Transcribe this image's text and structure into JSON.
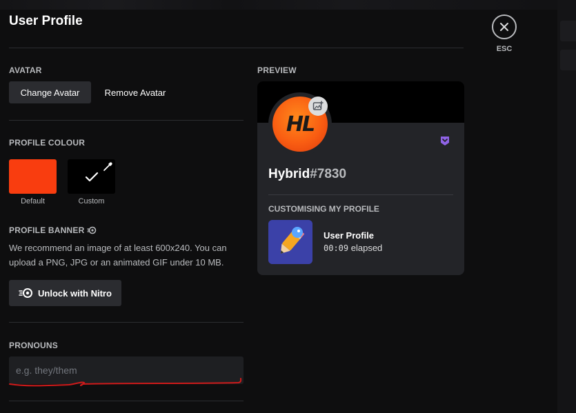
{
  "page": {
    "title": "User Profile"
  },
  "close": {
    "label": "ESC"
  },
  "avatar_section": {
    "label": "AVATAR",
    "change_label": "Change Avatar",
    "remove_label": "Remove Avatar"
  },
  "profile_colour": {
    "label": "PROFILE COLOUR",
    "default_label": "Default",
    "custom_label": "Custom",
    "default_color": "#f93d0f",
    "custom_color": "#000000"
  },
  "profile_banner": {
    "label": "PROFILE BANNER",
    "description": "We recommend an image of at least 600x240. You can upload a PNG, JPG or an animated GIF under 10 MB.",
    "nitro_button_label": "Unlock with Nitro"
  },
  "pronouns": {
    "label": "PRONOUNS",
    "placeholder": "e.g. they/them",
    "value": ""
  },
  "preview": {
    "label": "PREVIEW",
    "avatar_text": "HL",
    "username": "Hybrid",
    "discriminator": "#7830",
    "activity_header": "CUSTOMISING MY PROFILE",
    "activity_name": "User Profile",
    "activity_elapsed_time": "00:09",
    "activity_elapsed_suffix": "elapsed"
  },
  "colors": {
    "accent_nitro": "#8f63e6",
    "annotation": "#d11a1a"
  }
}
